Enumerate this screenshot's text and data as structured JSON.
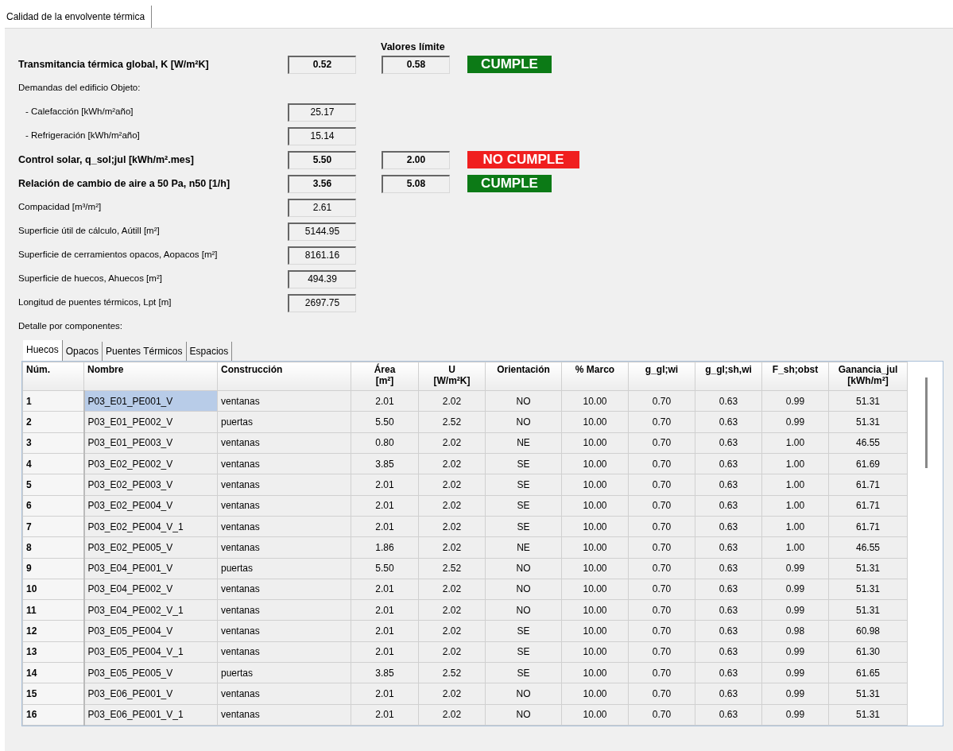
{
  "main_tabs": [
    {
      "label": "Calidad de la envolvente térmica",
      "selected": true
    }
  ],
  "limits_heading": "Valores límite",
  "items": [
    {
      "kind": "main",
      "label": "Transmitancia térmica global, K [W/m²K]",
      "value": "0.52",
      "limit": "0.58",
      "status": {
        "text": "CUMPLE",
        "passed": true
      }
    },
    {
      "kind": "heading",
      "label": "Demandas del edificio Objeto:"
    },
    {
      "kind": "sub",
      "label": "- Calefacción [kWh/m²año]",
      "value": "25.17"
    },
    {
      "kind": "sub",
      "label": "- Refrigeración [kWh/m²año]",
      "value": "15.14"
    },
    {
      "kind": "main",
      "label": "Control solar, q_sol;jul [kWh/m².mes]",
      "value": "5.50",
      "limit": "2.00",
      "status": {
        "text": "NO CUMPLE",
        "passed": false
      }
    },
    {
      "kind": "main",
      "label": "Relación de cambio de aire a 50 Pa, n50 [1/h]",
      "value": "3.56",
      "limit": "5.08",
      "status": {
        "text": "CUMPLE",
        "passed": true
      }
    },
    {
      "kind": "detail",
      "label": "Compacidad [m³/m²]",
      "value": "2.61"
    },
    {
      "kind": "detail",
      "label": "Superficie útil de cálculo, Aútill [m²]",
      "value": "5144.95"
    },
    {
      "kind": "detail",
      "label": "Superficie de cerramientos opacos, Aopacos [m²]",
      "value": "8161.16"
    },
    {
      "kind": "detail",
      "label": "Superficie de huecos, Ahuecos [m²]",
      "value": "494.39"
    },
    {
      "kind": "detail",
      "label": "Longitud de puentes térmicos, Lpt [m]",
      "value": "2697.75"
    },
    {
      "kind": "heading",
      "label": "Detalle por componentes:"
    }
  ],
  "detail_tabs": [
    {
      "label": "Huecos",
      "selected": true
    },
    {
      "label": "Opacos",
      "selected": false
    },
    {
      "label": "Puentes Térmicos",
      "selected": false
    },
    {
      "label": "Espacios",
      "selected": false
    }
  ],
  "table": {
    "columns": [
      "Núm.",
      "Nombre",
      "Construcción",
      "Área\n[m²]",
      "U\n[W/m²K]",
      "Orientación",
      "% Marco",
      "g_gl;wi",
      "g_gl;sh,wi",
      "F_sh;obst",
      "Ganancia_jul\n[kWh/m²]"
    ],
    "rows": [
      {
        "selected": true,
        "cells": [
          "1",
          "P03_E01_PE001_V",
          "ventanas",
          "2.01",
          "2.02",
          "NO",
          "10.00",
          "0.70",
          "0.63",
          "0.99",
          "51.31"
        ]
      },
      {
        "selected": false,
        "cells": [
          "2",
          "P03_E01_PE002_V",
          "puertas",
          "5.50",
          "2.52",
          "NO",
          "10.00",
          "0.70",
          "0.63",
          "0.99",
          "51.31"
        ]
      },
      {
        "selected": false,
        "cells": [
          "3",
          "P03_E01_PE003_V",
          "ventanas",
          "0.80",
          "2.02",
          "NE",
          "10.00",
          "0.70",
          "0.63",
          "1.00",
          "46.55"
        ]
      },
      {
        "selected": false,
        "cells": [
          "4",
          "P03_E02_PE002_V",
          "ventanas",
          "3.85",
          "2.02",
          "SE",
          "10.00",
          "0.70",
          "0.63",
          "1.00",
          "61.69"
        ]
      },
      {
        "selected": false,
        "cells": [
          "5",
          "P03_E02_PE003_V",
          "ventanas",
          "2.01",
          "2.02",
          "SE",
          "10.00",
          "0.70",
          "0.63",
          "1.00",
          "61.71"
        ]
      },
      {
        "selected": false,
        "cells": [
          "6",
          "P03_E02_PE004_V",
          "ventanas",
          "2.01",
          "2.02",
          "SE",
          "10.00",
          "0.70",
          "0.63",
          "1.00",
          "61.71"
        ]
      },
      {
        "selected": false,
        "cells": [
          "7",
          "P03_E02_PE004_V_1",
          "ventanas",
          "2.01",
          "2.02",
          "SE",
          "10.00",
          "0.70",
          "0.63",
          "1.00",
          "61.71"
        ]
      },
      {
        "selected": false,
        "cells": [
          "8",
          "P03_E02_PE005_V",
          "ventanas",
          "1.86",
          "2.02",
          "NE",
          "10.00",
          "0.70",
          "0.63",
          "1.00",
          "46.55"
        ]
      },
      {
        "selected": false,
        "cells": [
          "9",
          "P03_E04_PE001_V",
          "puertas",
          "5.50",
          "2.52",
          "NO",
          "10.00",
          "0.70",
          "0.63",
          "0.99",
          "51.31"
        ]
      },
      {
        "selected": false,
        "cells": [
          "10",
          "P03_E04_PE002_V",
          "ventanas",
          "2.01",
          "2.02",
          "NO",
          "10.00",
          "0.70",
          "0.63",
          "0.99",
          "51.31"
        ]
      },
      {
        "selected": false,
        "cells": [
          "11",
          "P03_E04_PE002_V_1",
          "ventanas",
          "2.01",
          "2.02",
          "NO",
          "10.00",
          "0.70",
          "0.63",
          "0.99",
          "51.31"
        ]
      },
      {
        "selected": false,
        "cells": [
          "12",
          "P03_E05_PE004_V",
          "ventanas",
          "2.01",
          "2.02",
          "SE",
          "10.00",
          "0.70",
          "0.63",
          "0.98",
          "60.98"
        ]
      },
      {
        "selected": false,
        "cells": [
          "13",
          "P03_E05_PE004_V_1",
          "ventanas",
          "2.01",
          "2.02",
          "SE",
          "10.00",
          "0.70",
          "0.63",
          "0.99",
          "61.30"
        ]
      },
      {
        "selected": false,
        "cells": [
          "14",
          "P03_E05_PE005_V",
          "puertas",
          "3.85",
          "2.52",
          "SE",
          "10.00",
          "0.70",
          "0.63",
          "0.99",
          "61.65"
        ]
      },
      {
        "selected": false,
        "cells": [
          "15",
          "P03_E06_PE001_V",
          "ventanas",
          "2.01",
          "2.02",
          "NO",
          "10.00",
          "0.70",
          "0.63",
          "0.99",
          "51.31"
        ]
      },
      {
        "selected": false,
        "cells": [
          "16",
          "P03_E06_PE001_V_1",
          "ventanas",
          "2.01",
          "2.02",
          "NO",
          "10.00",
          "0.70",
          "0.63",
          "0.99",
          "51.31"
        ]
      }
    ]
  }
}
